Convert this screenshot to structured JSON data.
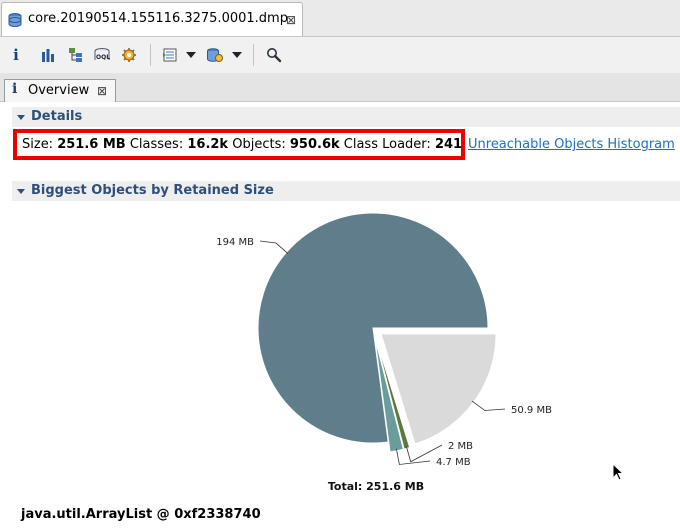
{
  "editor_tab": {
    "label": "core.20190514.155116.3275.0001.dmp"
  },
  "toolbar": {
    "buttons": [
      "info-icon",
      "histogram-icon",
      "dominator-tree-icon",
      "oql-icon",
      "heap-dump-overview-icon",
      "query-browser-icon",
      "find-object-icon"
    ],
    "colors": {
      "bar_blue": "#2b5a9c"
    }
  },
  "inner_tab": {
    "label": "Overview"
  },
  "details": {
    "title": "Details",
    "size_label": "Size:",
    "size_value": "251.6 MB",
    "classes_label": "Classes:",
    "classes_value": "16.2k",
    "objects_label": "Objects:",
    "objects_value": "950.6k",
    "loader_label": "Class Loader:",
    "loader_value": "241",
    "highlight_color": "#ee0000",
    "link": "Unreachable Objects Histogram"
  },
  "biggest": {
    "title": "Biggest Objects by Retained Size"
  },
  "chart_data": {
    "type": "pie",
    "title": "",
    "slices": [
      {
        "value": 194,
        "label": "194 MB",
        "color": "#607d8b"
      },
      {
        "value": 4.7,
        "label": "4.7 MB",
        "color": "#6b9c9c"
      },
      {
        "value": 2,
        "label": "2 MB",
        "color": "#5b7a3c"
      },
      {
        "value": 50.9,
        "label": "50.9 MB",
        "color": "#dadada"
      }
    ],
    "total_label": "Total: 251.6 MB"
  },
  "selected_object": {
    "label": "java.util.ArrayList @ 0xf2338740"
  }
}
